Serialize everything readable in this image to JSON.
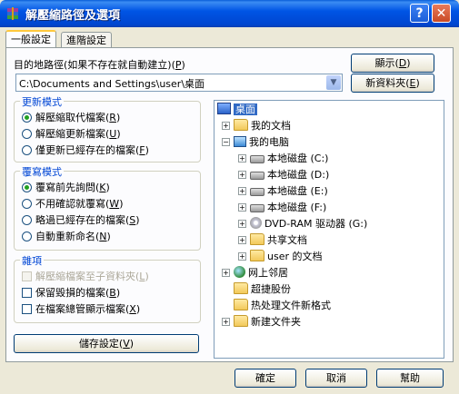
{
  "window": {
    "title": "解壓縮路徑及選項",
    "help_glyph": "?",
    "close_glyph": "✕"
  },
  "tabs": [
    {
      "label": "一般設定",
      "active": true
    },
    {
      "label": "進階設定",
      "active": false
    }
  ],
  "dest": {
    "label": "目的地路徑(如果不存在就自動建立)(",
    "label_key": "P",
    "label_end": ")",
    "value": "C:\\Documents and Settings\\user\\桌面"
  },
  "buttons": {
    "show": {
      "label": "顯示(",
      "key": "D",
      "end": ")"
    },
    "new_folder": {
      "label": "新資料夾(",
      "key": "E",
      "end": ")"
    },
    "save": {
      "label": "儲存設定(",
      "key": "V",
      "end": ")"
    },
    "ok": "確定",
    "cancel": "取消",
    "help": "幫助"
  },
  "update_mode": {
    "title": "更新模式",
    "options": [
      {
        "label": "解壓縮取代檔案(",
        "key": "R",
        "selected": true
      },
      {
        "label": "解壓縮更新檔案(",
        "key": "U",
        "selected": false
      },
      {
        "label": "僅更新已經存在的檔案(",
        "key": "F",
        "selected": false
      }
    ]
  },
  "overwrite_mode": {
    "title": "覆寫模式",
    "options": [
      {
        "label": "覆寫前先詢問(",
        "key": "K",
        "selected": true
      },
      {
        "label": "不用確認就覆寫(",
        "key": "W",
        "selected": false
      },
      {
        "label": "略過已經存在的檔案(",
        "key": "S",
        "selected": false
      },
      {
        "label": "自動重新命名(",
        "key": "N",
        "selected": false
      }
    ]
  },
  "misc": {
    "title": "雜項",
    "options": [
      {
        "label": "解壓縮檔案至子資料夾(",
        "key": "L",
        "checked": false,
        "disabled": true
      },
      {
        "label": "保留毀損的檔案(",
        "key": "B",
        "checked": false,
        "disabled": false
      },
      {
        "label": "在檔案總管顯示檔案(",
        "key": "X",
        "checked": false,
        "disabled": false
      }
    ]
  },
  "tree": [
    {
      "label": "桌面",
      "icon": "desktop-icon"
    },
    {
      "label": "我的文档",
      "icon": "folder-icon"
    },
    {
      "label": "我的电脑",
      "icon": "computer-icon"
    },
    {
      "label": "本地磁盘 (C:)",
      "icon": "drive-icon"
    },
    {
      "label": "本地磁盘 (D:)",
      "icon": "drive-icon"
    },
    {
      "label": "本地磁盘 (E:)",
      "icon": "drive-icon"
    },
    {
      "label": "本地磁盘 (F:)",
      "icon": "drive-icon"
    },
    {
      "label": "DVD-RAM 驱动器 (G:)",
      "icon": "dvd-icon"
    },
    {
      "label": "共享文档",
      "icon": "folder-icon"
    },
    {
      "label": "user 的文档",
      "icon": "folder-icon"
    },
    {
      "label": "网上邻居",
      "icon": "network-icon"
    },
    {
      "label": "超捷股份",
      "icon": "folder-icon"
    },
    {
      "label": "热处理文件新格式",
      "icon": "folder-icon"
    },
    {
      "label": "新建文件夹",
      "icon": "folder-icon"
    }
  ],
  "expander": {
    "plus": "+",
    "minus": "−"
  },
  "dropdown_glyph": "▼"
}
